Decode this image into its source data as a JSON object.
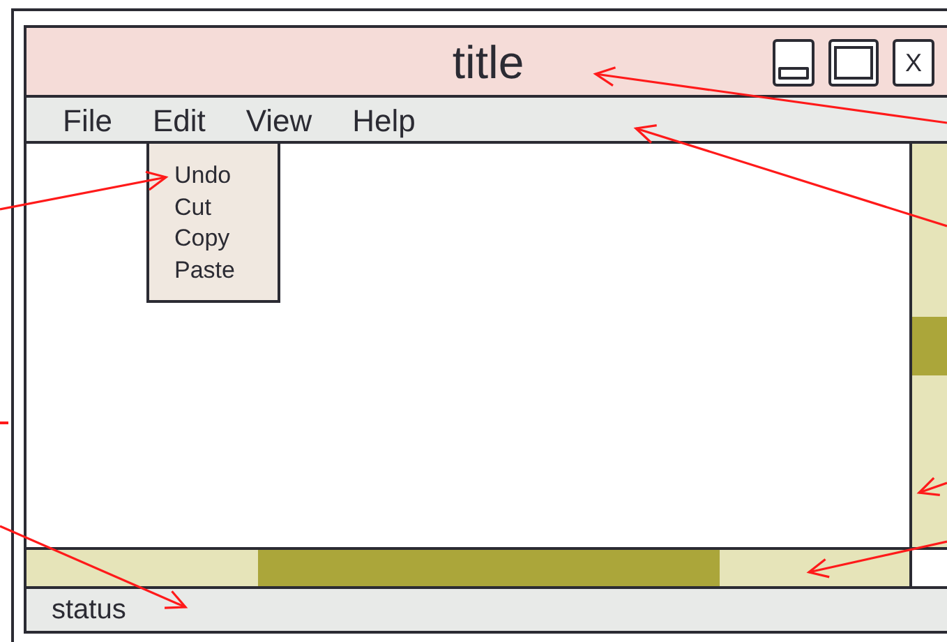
{
  "window": {
    "title": "title",
    "close_label": "X"
  },
  "menu": [
    {
      "label": "File"
    },
    {
      "label": "Edit",
      "dropdown": [
        "Undo",
        "Cut",
        "Copy",
        "Paste"
      ]
    },
    {
      "label": "View"
    },
    {
      "label": "Help"
    }
  ],
  "status_bar": "status"
}
